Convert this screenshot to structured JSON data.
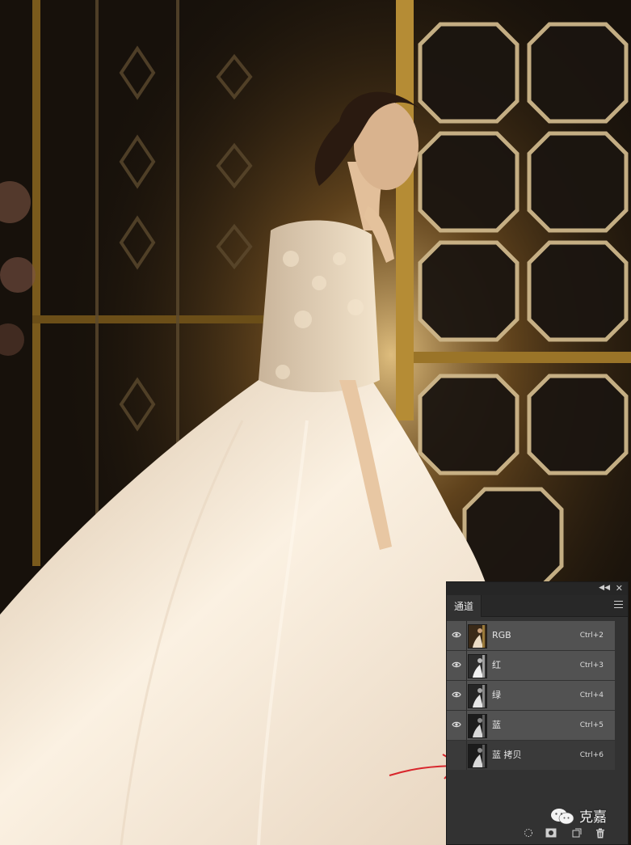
{
  "panel": {
    "tab_label": "通道",
    "channels": [
      {
        "name": "RGB",
        "shortcut": "Ctrl+2",
        "visible": true
      },
      {
        "name": "红",
        "shortcut": "Ctrl+3",
        "visible": true
      },
      {
        "name": "绿",
        "shortcut": "Ctrl+4",
        "visible": true
      },
      {
        "name": "蓝",
        "shortcut": "Ctrl+5",
        "visible": true
      },
      {
        "name": "蓝 拷贝",
        "shortcut": "Ctrl+6",
        "visible": false
      }
    ]
  },
  "watermark": {
    "text": "克嘉"
  },
  "colors": {
    "annotation_arrow": "#d8262c",
    "panel_bg": "#323232",
    "row_selected": "#525252"
  }
}
